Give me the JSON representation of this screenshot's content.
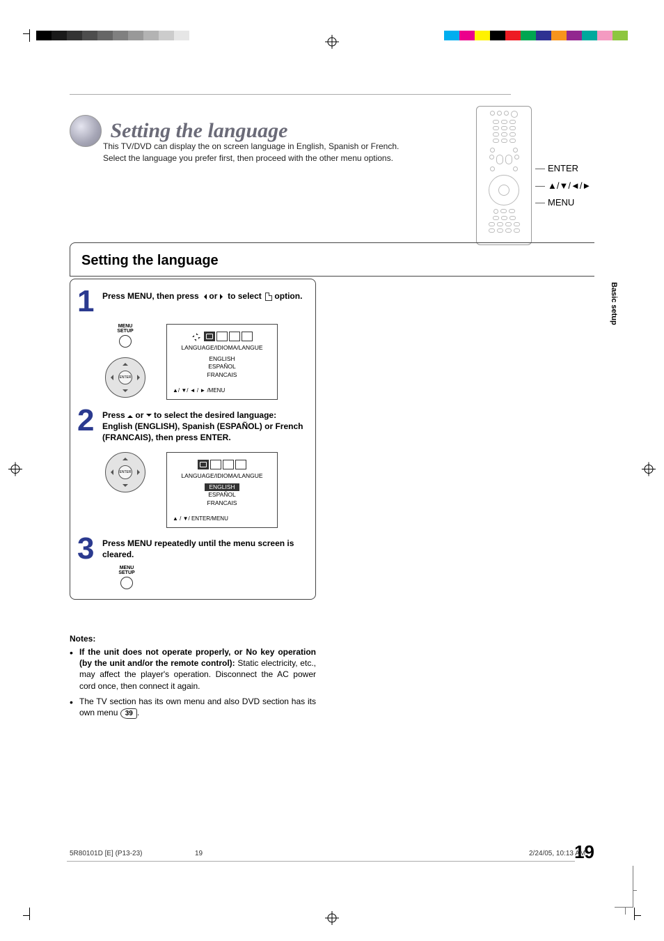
{
  "print": {
    "grayscale": [
      "#000000",
      "#1a1a1a",
      "#333333",
      "#4d4d4d",
      "#666666",
      "#808080",
      "#999999",
      "#b3b3b3",
      "#cccccc",
      "#e6e6e6",
      "#ffffff"
    ],
    "cmyk": [
      "#00aeef",
      "#ec008c",
      "#fff200",
      "#000000",
      "#ed1c24",
      "#00a651",
      "#2e3192",
      "#f7941d",
      "#92278f",
      "#00a99d",
      "#f49ac1",
      "#8dc63f"
    ]
  },
  "title": "Setting the language",
  "intro": "This TV/DVD can display the on screen language in English, Spanish or French. Select the language you prefer first, then proceed with the other menu options.",
  "remote_labels": [
    "ENTER",
    "▲/▼/◄/►",
    "MENU"
  ],
  "section_title": "Setting the language",
  "steps": {
    "s1": {
      "text_a": "Press MENU, then press ",
      "text_b": " or ",
      "text_c": " to select ",
      "text_d": " option."
    },
    "s2": {
      "text_a": "Press ",
      "text_b": " or ",
      "text_c": " to select the desired language: English (ENGLISH), Spanish (ESPAÑOL) or French (FRANCAIS), then press ENTER."
    },
    "s3": {
      "text": "Press MENU repeatedly until the menu screen is cleared."
    }
  },
  "menu_btn_label": "MENU\nSETUP",
  "dpad_center": "ENTER",
  "osd": {
    "label": "LANGUAGE/IDIOMA/LANGUE",
    "items": [
      "ENGLISH",
      "ESPAÑOL",
      "FRANCAIS"
    ],
    "foot1": "▲/ ▼/ ◄ / ► /MENU",
    "foot2": "▲ / ▼/ ENTER/MENU"
  },
  "notes": {
    "heading": "Notes:",
    "n1_bold": "If the unit does not operate properly, or No key operation (by the unit and/or the remote control):",
    "n1_rest": " Static electricity, etc., may affect the player's operation. Disconnect the AC power cord once, then connect it again.",
    "n2_a": "The TV section has its own menu and also DVD section has its own menu ",
    "n2_ref": "39",
    "n2_b": "."
  },
  "side_tab": "Basic setup",
  "page_number": "19",
  "footer": {
    "doc": "5R80101D [E] (P13-23)",
    "pg": "19",
    "date": "2/24/05, 10:13 AM"
  }
}
